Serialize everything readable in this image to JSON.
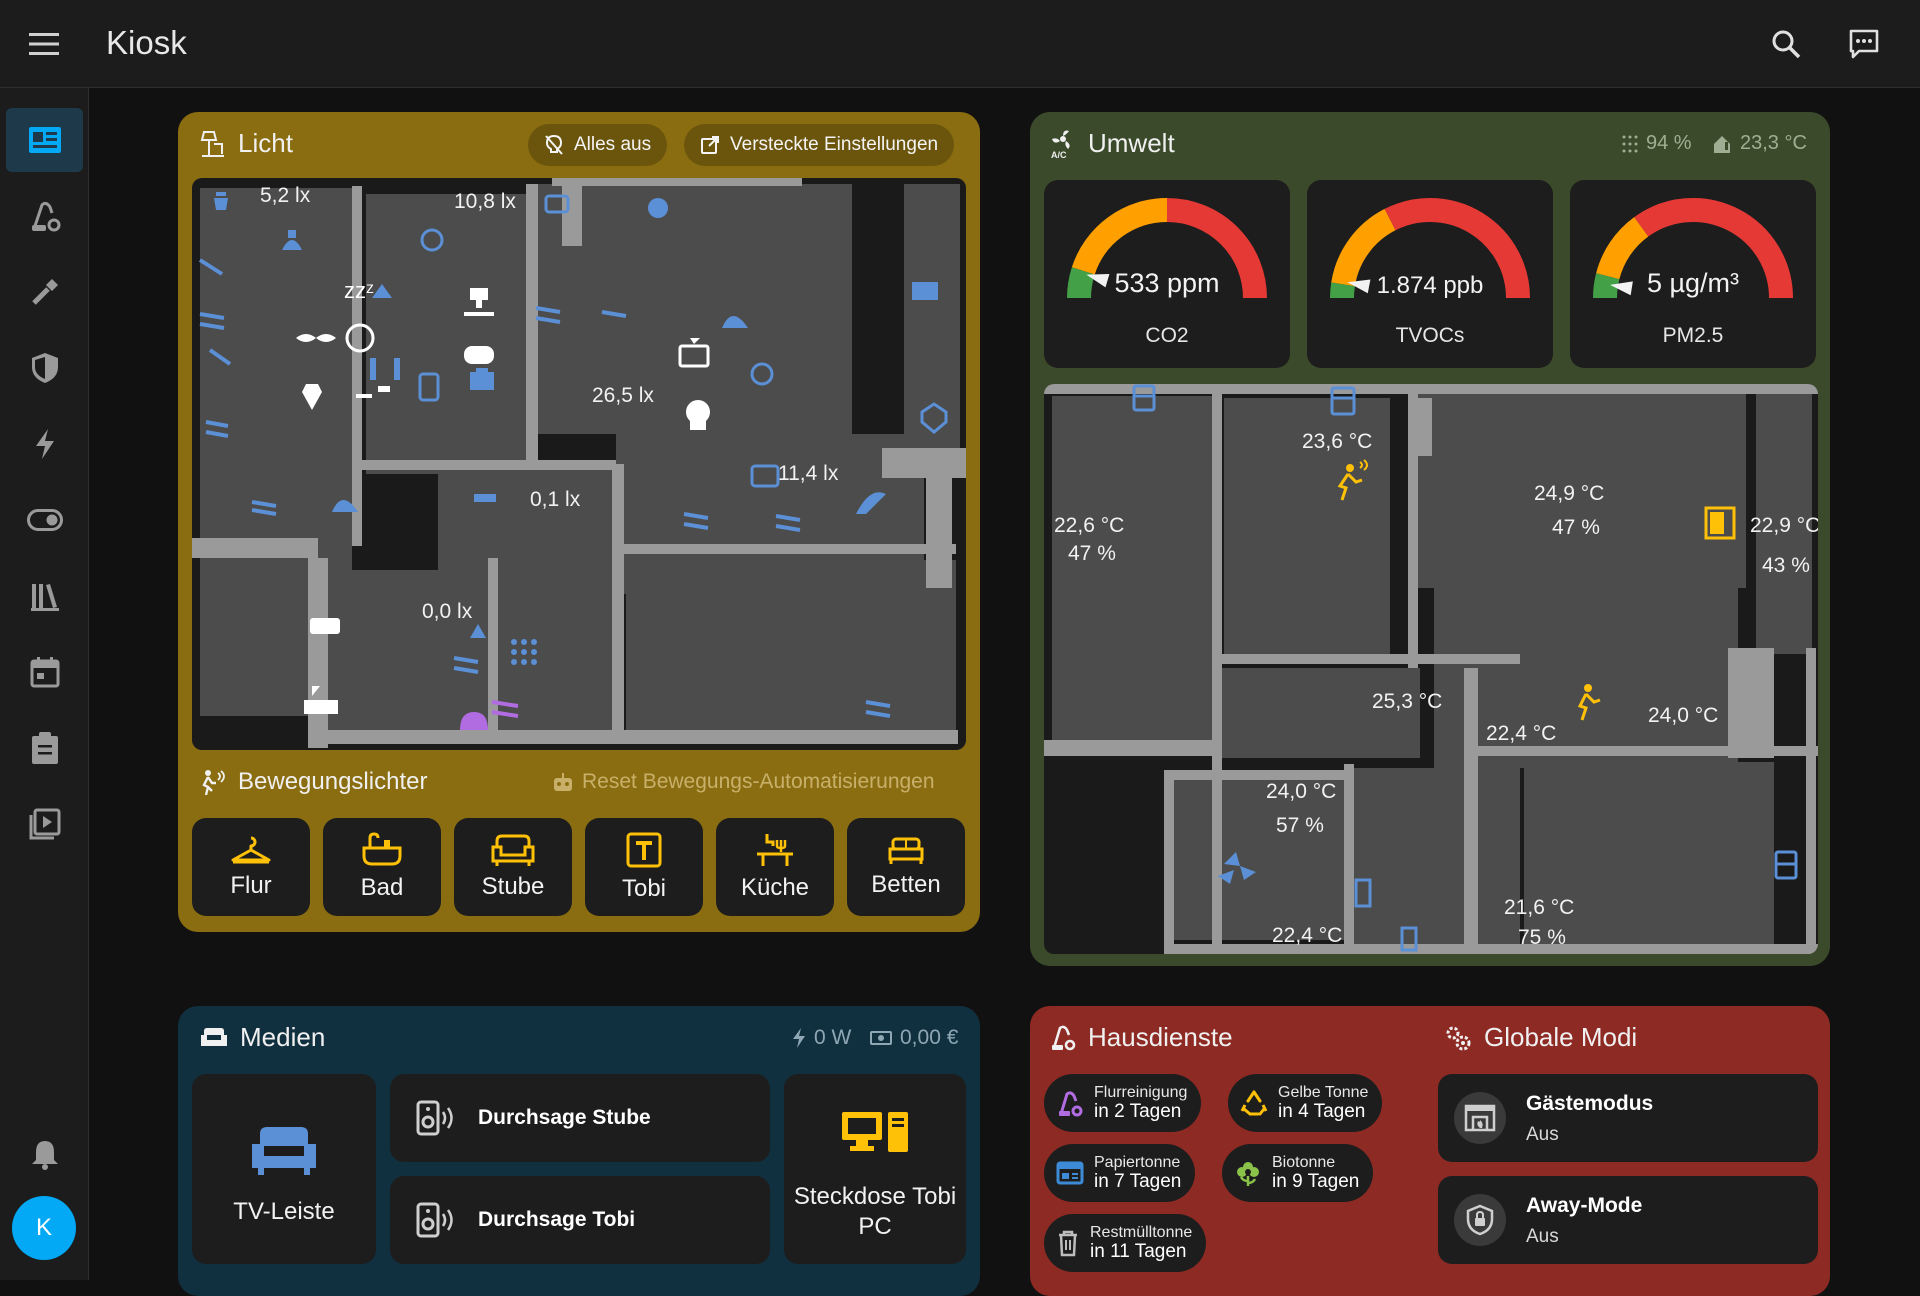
{
  "app": {
    "title": "Kiosk",
    "avatar_letter": "K"
  },
  "icons": {
    "menu": "menu-icon",
    "search": "search-icon",
    "assist": "assist-icon",
    "sidebar": [
      "dashboard-icon",
      "vacuum-icon",
      "tools-icon",
      "shield-icon",
      "energy-icon",
      "toggle-icon",
      "library-icon",
      "calendar-icon",
      "clipboard-icon",
      "media-icon"
    ],
    "bell": "bell-icon"
  },
  "colors": {
    "licht": "#8a6d10",
    "umwelt": "#3a4a2a",
    "medien": "#11303f",
    "hausdienste": "#8e2a24",
    "accent_yellow": "#ffc107",
    "icon_blue": "#5b8fd6"
  },
  "licht": {
    "title": "Licht",
    "chips": {
      "all_off": "Alles aus",
      "hidden_settings": "Versteckte Einstellungen"
    },
    "lux": [
      "5,2 lx",
      "10,8 lx",
      "26,5 lx",
      "11,4 lx",
      "0,1 lx",
      "0,0 lx"
    ],
    "motion_title": "Bewegungslichter",
    "reset_label": "Reset Bewegungs-Automatisierungen",
    "buttons": [
      "Flur",
      "Bad",
      "Stube",
      "Tobi",
      "Küche",
      "Betten"
    ]
  },
  "umwelt": {
    "title": "Umwelt",
    "humidity": "94 %",
    "temperature": "23,3 °C",
    "gauges": [
      {
        "value_text": "533 ppm",
        "label": "CO2",
        "fraction": 0.09
      },
      {
        "value_text": "1.874 ppb",
        "label": "TVOCs",
        "fraction": 0.06
      },
      {
        "value_text": "5 µg/m³",
        "label": "PM2.5",
        "fraction": 0.05
      }
    ],
    "floor_labels": {
      "r1_temp": "22,6 °C",
      "r1_hum": "47 %",
      "r2_temp": "23,6 °C",
      "r3_temp": "24,9 °C",
      "r3_hum": "47 %",
      "r4_temp": "22,9 °C",
      "r4_hum": "43 %",
      "r5_temp": "25,3 °C",
      "r6_temp": "22,4 °C",
      "r6b_temp": "24,0 °C",
      "r7_temp": "24,0 °C",
      "r7_hum": "57 %",
      "r8_temp": "22,4 °C",
      "r9_temp": "21,6 °C",
      "r9_hum": "75 %"
    }
  },
  "medien": {
    "title": "Medien",
    "power": "0 W",
    "cost": "0,00 €",
    "tv": "TV-Leiste",
    "announce_stube": "Durchsage Stube",
    "announce_tobi": "Durchsage Tobi",
    "socket": "Steckdose Tobi PC"
  },
  "hausdienste": {
    "title": "Hausdienste",
    "pills": [
      {
        "t1": "Flurreinigung",
        "t2": "in 2 Tagen"
      },
      {
        "t1": "Gelbe Tonne",
        "t2": "in 4 Tagen"
      },
      {
        "t1": "Papiertonne",
        "t2": "in 7 Tagen"
      },
      {
        "t1": "Biotonne",
        "t2": "in 9 Tagen"
      },
      {
        "t1": "Restmülltonne",
        "t2": "in 11 Tagen"
      }
    ]
  },
  "modi": {
    "title": "Globale Modi",
    "items": [
      {
        "name": "Gästemodus",
        "state": "Aus"
      },
      {
        "name": "Away-Mode",
        "state": "Aus"
      }
    ]
  }
}
